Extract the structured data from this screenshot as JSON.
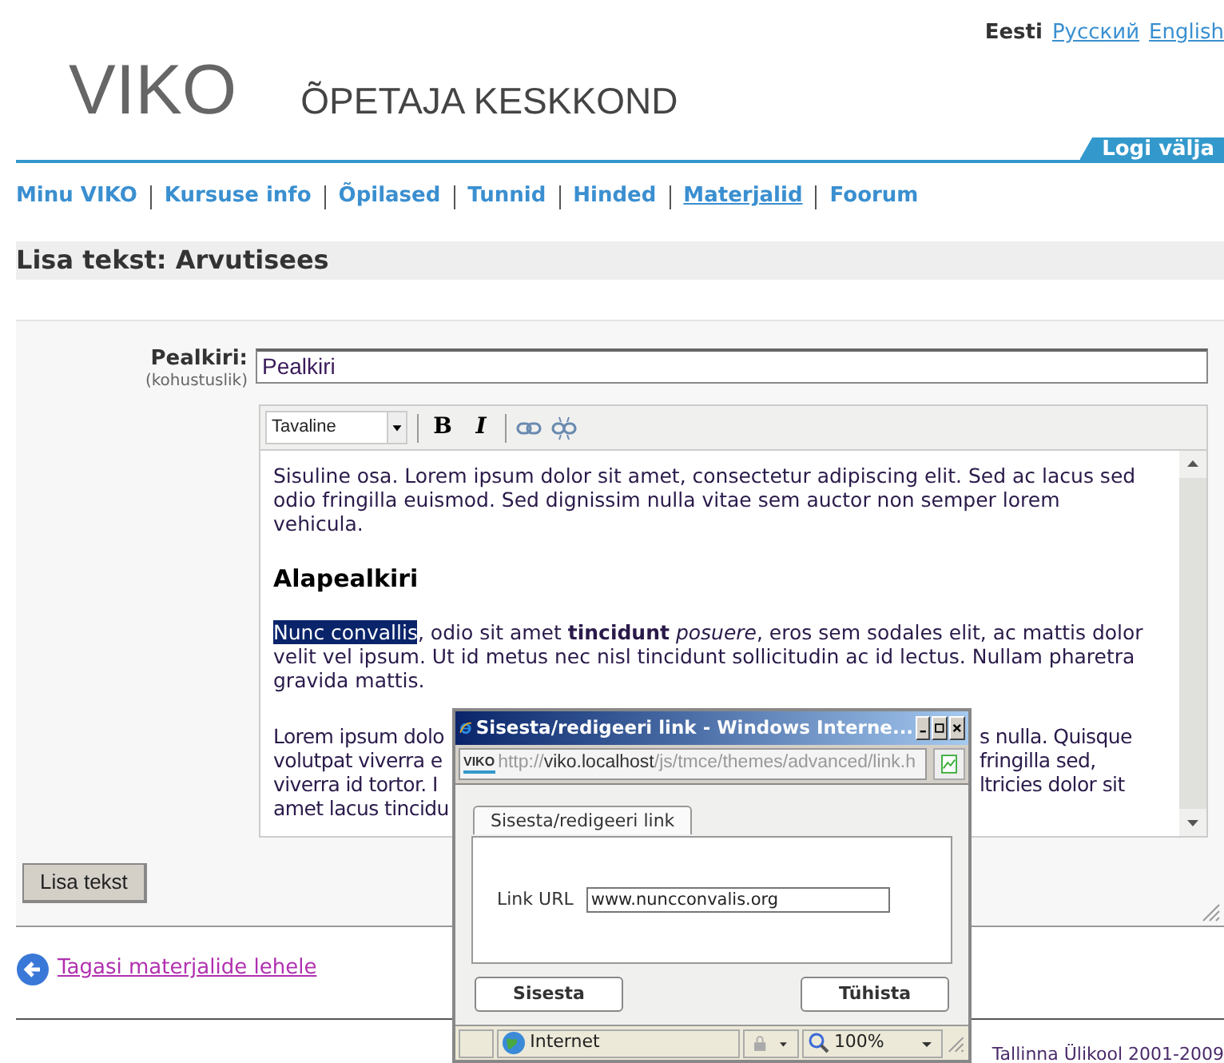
{
  "languages": [
    {
      "label": "Eesti",
      "selected": true
    },
    {
      "label": "Русский",
      "selected": false
    },
    {
      "label": "English",
      "selected": false
    }
  ],
  "logo": "VIKO",
  "subtitle": "ÕPETAJA KESKKOND",
  "logout": "Logi välja",
  "nav": [
    {
      "label": "Minu VIKO",
      "selected": false
    },
    {
      "label": "Kursuse info",
      "selected": false
    },
    {
      "label": "Õpilased",
      "selected": false
    },
    {
      "label": "Tunnid",
      "selected": false
    },
    {
      "label": "Hinded",
      "selected": false
    },
    {
      "label": "Materjalid",
      "selected": true
    },
    {
      "label": "Foorum",
      "selected": false
    }
  ],
  "page_title": "Lisa tekst: Arvutisees",
  "form": {
    "title_label": "Pealkiri:",
    "required_note": "(kohustuslik)",
    "title_value": "Pealkiri",
    "editor": {
      "format": "Tavaline",
      "bold_button": "B",
      "italic_button": "I",
      "paragraph_1": "Sisuline osa. Lorem ipsum dolor sit amet, consectetur adipiscing elit. Sed ac lacus sed odio fringilla euismod. Sed dignissim nulla vitae sem auctor non semper lorem vehicula.",
      "heading": "Alapealkiri",
      "paragraph_2": {
        "highlight": {
          "text": "Nunc convallis",
          "selected": true
        },
        "rest": ", odio sit amet **tincidunt** *posuere*, eros sem sodales elit, ac mattis dolor velit vel ipsum. Ut id metus nec nisl tincidunt sollicitudin ac id lectus. Nullam pharetra gravida mattis."
      },
      "paragraph_3": [
        {
          "left": "Lorem ipsum dolo",
          "right": "s nulla. Quisque"
        },
        {
          "left": "volutpat viverra e",
          "right": "fringilla sed,"
        },
        {
          "left": "viverra id tortor. I",
          "right": "ltricies dolor sit"
        },
        {
          "left": "amet lacus tincidu"
        }
      ]
    },
    "submit": "Lisa tekst"
  },
  "back_link": "Tagasi materjalide lehele",
  "footer": "Tallinna Ülikool 2001-2009",
  "popup": {
    "title": "Sisesta/redigeeri link - Windows Interne...",
    "favicon": "VIKO",
    "url_scheme": "http://",
    "url_host": "viko.localhost",
    "url_path": "/js/tmce/themes/advanced/link.h",
    "tab": "Sisesta/redigeeri link",
    "url_label": "Link URL",
    "url_value": "www.nuncconvalis.org",
    "insert": "Sisesta",
    "cancel": "Tühista",
    "zone": "Internet",
    "zoom": "100%"
  }
}
